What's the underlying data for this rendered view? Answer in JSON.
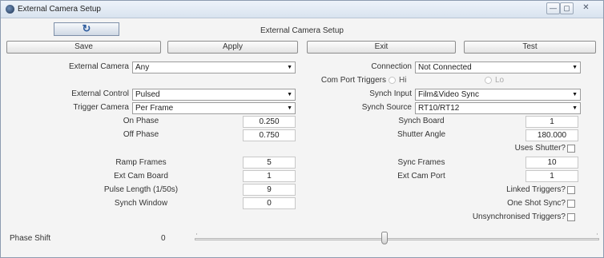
{
  "window": {
    "title": "External Camera Setup",
    "min_glyph": "—",
    "max_glyph": "▢",
    "close_glyph": "✕"
  },
  "header": {
    "title": "External Camera Setup",
    "refresh_glyph": "↻"
  },
  "toolbar": {
    "save": "Save",
    "apply": "Apply",
    "exit": "Exit",
    "test": "Test"
  },
  "left": {
    "external_camera": {
      "label": "External Camera",
      "value": "Any"
    },
    "external_control": {
      "label": "External Control",
      "value": "Pulsed"
    },
    "trigger_camera": {
      "label": "Trigger Camera",
      "value": "Per Frame"
    },
    "on_phase": {
      "label": "On Phase",
      "value": "0.250"
    },
    "off_phase": {
      "label": "Off Phase",
      "value": "0.750"
    },
    "ramp_frames": {
      "label": "Ramp Frames",
      "value": "5"
    },
    "ext_cam_board": {
      "label": "Ext Cam Board",
      "value": "1"
    },
    "pulse_length": {
      "label": "Pulse Length (1/50s)",
      "value": "9"
    },
    "synch_window": {
      "label": "Synch Window",
      "value": "0"
    }
  },
  "right": {
    "connection": {
      "label": "Connection",
      "value": "Not Connected"
    },
    "com_port_triggers": {
      "label": "Com Port Triggers",
      "hi": "Hi",
      "lo": "Lo"
    },
    "synch_input": {
      "label": "Synch Input",
      "value": "Film&Video Sync"
    },
    "synch_source": {
      "label": "Synch Source",
      "value": "RT10/RT12"
    },
    "synch_board": {
      "label": "Synch Board",
      "value": "1"
    },
    "shutter_angle": {
      "label": "Shutter Angle",
      "value": "180.000"
    },
    "uses_shutter": {
      "label": "Uses Shutter?"
    },
    "sync_frames": {
      "label": "Sync Frames",
      "value": "10"
    },
    "ext_cam_port": {
      "label": "Ext Cam Port",
      "value": "1"
    },
    "linked_triggers": {
      "label": "Linked Triggers?"
    },
    "one_shot_sync": {
      "label": "One Shot Sync?"
    },
    "unsynchronised_triggers": {
      "label": "Unsynchronised Triggers?"
    }
  },
  "phase_shift": {
    "label": "Phase Shift",
    "value": "0",
    "slider_fraction": 0.47
  },
  "colors": {
    "refresh_icon": "#2f5d9e",
    "window_border": "#8d9bb0"
  }
}
